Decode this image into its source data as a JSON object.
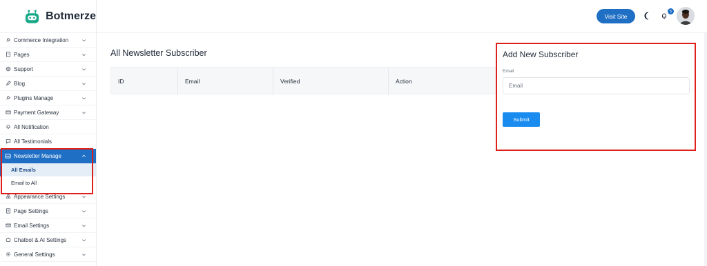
{
  "brand": {
    "name": "Botmerze",
    "accent": "#1f6fc5",
    "logo_color": "#1aa889"
  },
  "sidebar": {
    "items": [
      {
        "label": "Commerce Integration",
        "icon": "plug-icon",
        "chevron": true
      },
      {
        "label": "Pages",
        "icon": "file-icon",
        "chevron": true
      },
      {
        "label": "Support",
        "icon": "support-icon",
        "chevron": true
      },
      {
        "label": "Blog",
        "icon": "blog-icon",
        "chevron": true
      },
      {
        "label": "Plugins Manage",
        "icon": "plug-icon",
        "chevron": true
      },
      {
        "label": "Payment Gateway",
        "icon": "payment-icon",
        "chevron": true
      },
      {
        "label": "All Notification",
        "icon": "bell-icon",
        "chevron": false
      },
      {
        "label": "All Testimonials",
        "icon": "comment-icon",
        "chevron": false
      },
      {
        "label": "Newsletter Manage",
        "icon": "newsletter-icon",
        "chevron": true,
        "active": true
      },
      {
        "label": "Appearance Settings",
        "icon": "appearance-icon",
        "chevron": true
      },
      {
        "label": "Page Settings",
        "icon": "page-settings-icon",
        "chevron": true
      },
      {
        "label": "Email Settings",
        "icon": "mail-icon",
        "chevron": true
      },
      {
        "label": "Chatbot & AI Settings",
        "icon": "chatbot-icon",
        "chevron": true
      },
      {
        "label": "General Settings",
        "icon": "gear-icon",
        "chevron": true
      }
    ],
    "newsletter_sub": [
      {
        "label": "All Emails",
        "active": true
      },
      {
        "label": "Email to All",
        "active": false
      }
    ]
  },
  "topbar": {
    "visit_site": "Visit Site",
    "notification_count": "5"
  },
  "main": {
    "title": "All Newsletter Subscriber",
    "columns": [
      "ID",
      "Email",
      "Verified",
      "Action"
    ]
  },
  "add_form": {
    "title": "Add New Subscriber",
    "email_label": "Email",
    "email_placeholder": "Email",
    "submit_label": "Submit"
  }
}
